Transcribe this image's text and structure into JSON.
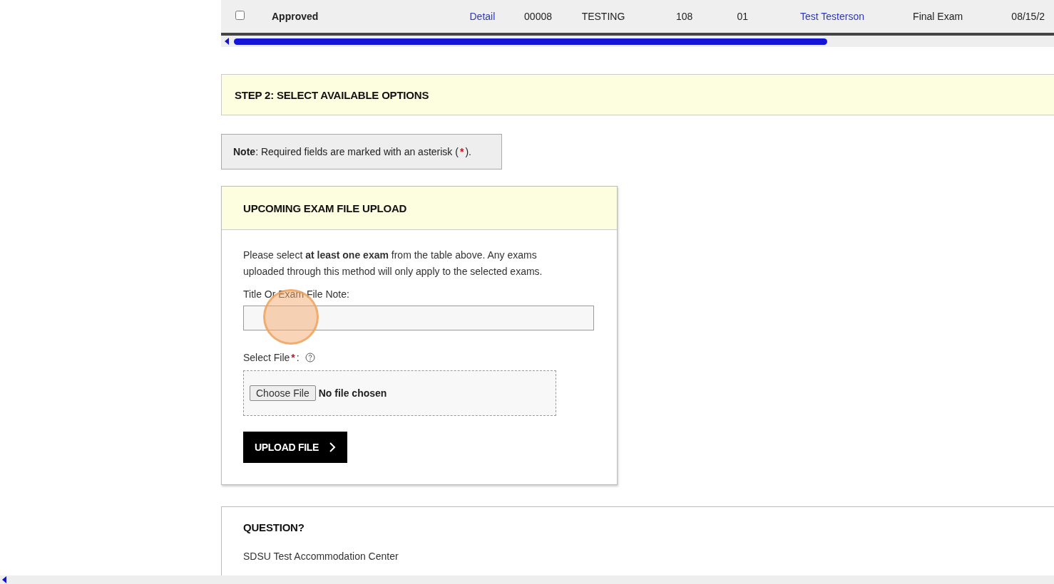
{
  "table_row": {
    "checked": false,
    "status": "Approved",
    "cells": [
      {
        "text": "Detail",
        "kind": "link"
      },
      {
        "text": "00008",
        "kind": "text"
      },
      {
        "text": "TESTING",
        "kind": "text"
      },
      {
        "text": "108",
        "kind": "text"
      },
      {
        "text": "01",
        "kind": "text"
      },
      {
        "text": "Test Testerson",
        "kind": "link"
      },
      {
        "text": "Final Exam",
        "kind": "text"
      },
      {
        "text": "08/15/2",
        "kind": "text"
      }
    ]
  },
  "step_banner": {
    "title": "STEP 2: SELECT AVAILABLE OPTIONS"
  },
  "note": {
    "text": "**Note**: Required fields are marked with an asterisk (",
    "asterisk": "*",
    "end": ")."
  },
  "upload_card": {
    "title": "UPCOMING EXAM FILE UPLOAD",
    "description": "Please select **at least one exam** from the table above. Any exams uploaded through this method will only apply to the selected exams.",
    "title_field": {
      "label": "Title Or Exam File Note:"
    },
    "file_field": {
      "label": "Select File",
      "asterisk": "*",
      "colon": ":",
      "button": "Choose File",
      "status": "No file chosen"
    },
    "upload_button": "UPLOAD FILE"
  },
  "question": {
    "title": "QUESTION?",
    "text": "SDSU Test Accommodation Center"
  }
}
